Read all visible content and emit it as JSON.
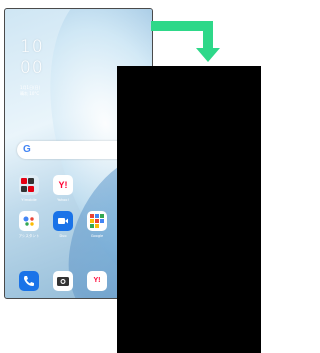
{
  "lockscreen": {
    "hour": "10",
    "minute": "00",
    "date_line": "1月1日(日)",
    "weather_line": "晴れ 10°C"
  },
  "search": {
    "logo": "G",
    "mic_icon": "mic-icon"
  },
  "apps": {
    "row1": [
      {
        "label": "Y!mobile",
        "icon": "ymobile-folder-icon"
      },
      {
        "label": "Yahoo!",
        "icon": "yahoo-icon",
        "glyph": "Y!"
      }
    ],
    "row2": [
      {
        "label": "アシスタント",
        "icon": "assistant-icon"
      },
      {
        "label": "Duo",
        "icon": "duo-icon"
      },
      {
        "label": "Google",
        "icon": "google-folder-icon"
      }
    ]
  },
  "dock": [
    {
      "icon": "phone-icon"
    },
    {
      "icon": "camera-icon"
    },
    {
      "icon": "yahoo-star-icon",
      "glyph": "Y!"
    }
  ],
  "colors": {
    "arrow": "#2ed889",
    "panel": "#000000",
    "accent": "#1a73e8"
  }
}
